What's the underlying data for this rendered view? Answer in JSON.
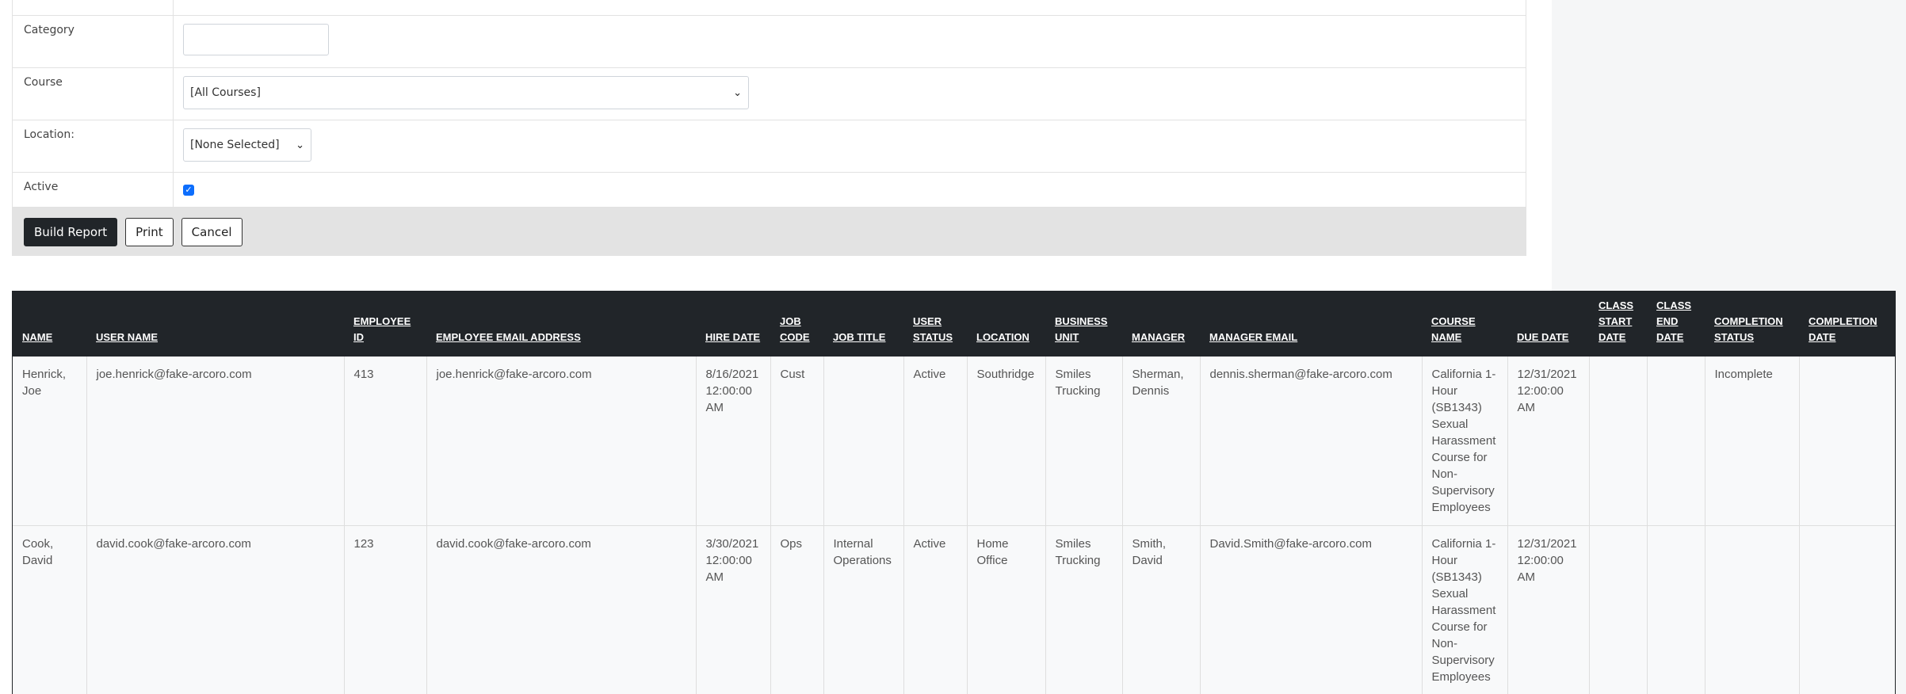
{
  "form": {
    "category_label": "Category",
    "category_value": "",
    "course_label": "Course",
    "course_selected": "[All Courses]",
    "location_label": "Location:",
    "location_selected": "[None Selected]",
    "active_label": "Active",
    "active_checked": true
  },
  "buttons": {
    "build_report": "Build Report",
    "print": "Print",
    "cancel": "Cancel"
  },
  "table": {
    "columns": [
      "NAME",
      "USER NAME",
      "EMPLOYEE ID",
      "EMPLOYEE EMAIL ADDRESS",
      "HIRE DATE",
      "JOB CODE",
      "JOB TITLE",
      "USER STATUS",
      "LOCATION",
      "BUSINESS UNIT",
      "MANAGER",
      "MANAGER EMAIL",
      "COURSE NAME",
      "DUE DATE",
      "CLASS START DATE",
      "CLASS END DATE",
      "COMPLETION STATUS",
      "COMPLETION DATE"
    ],
    "rows": [
      [
        "Henrick, Joe",
        "joe.henrick@fake-arcoro.com",
        "413",
        "joe.henrick@fake-arcoro.com",
        "8/16/2021 12:00:00 AM",
        "Cust",
        "",
        "Active",
        "Southridge",
        "Smiles Trucking",
        "Sherman, Dennis",
        "dennis.sherman@fake-arcoro.com",
        "California 1-Hour (SB1343) Sexual Harassment Course for Non-Supervisory Employees",
        "12/31/2021 12:00:00 AM",
        "",
        "",
        "Incomplete",
        ""
      ],
      [
        "Cook, David",
        "david.cook@fake-arcoro.com",
        "123",
        "david.cook@fake-arcoro.com",
        "3/30/2021 12:00:00 AM",
        "Ops",
        "Internal Operations",
        "Active",
        "Home Office",
        "Smiles Trucking",
        "Smith, David",
        "David.Smith@fake-arcoro.com",
        "California 1-Hour (SB1343) Sexual Harassment Course for Non-Supervisory Employees",
        "12/31/2021 12:00:00 AM",
        "",
        "",
        "",
        ""
      ]
    ]
  }
}
